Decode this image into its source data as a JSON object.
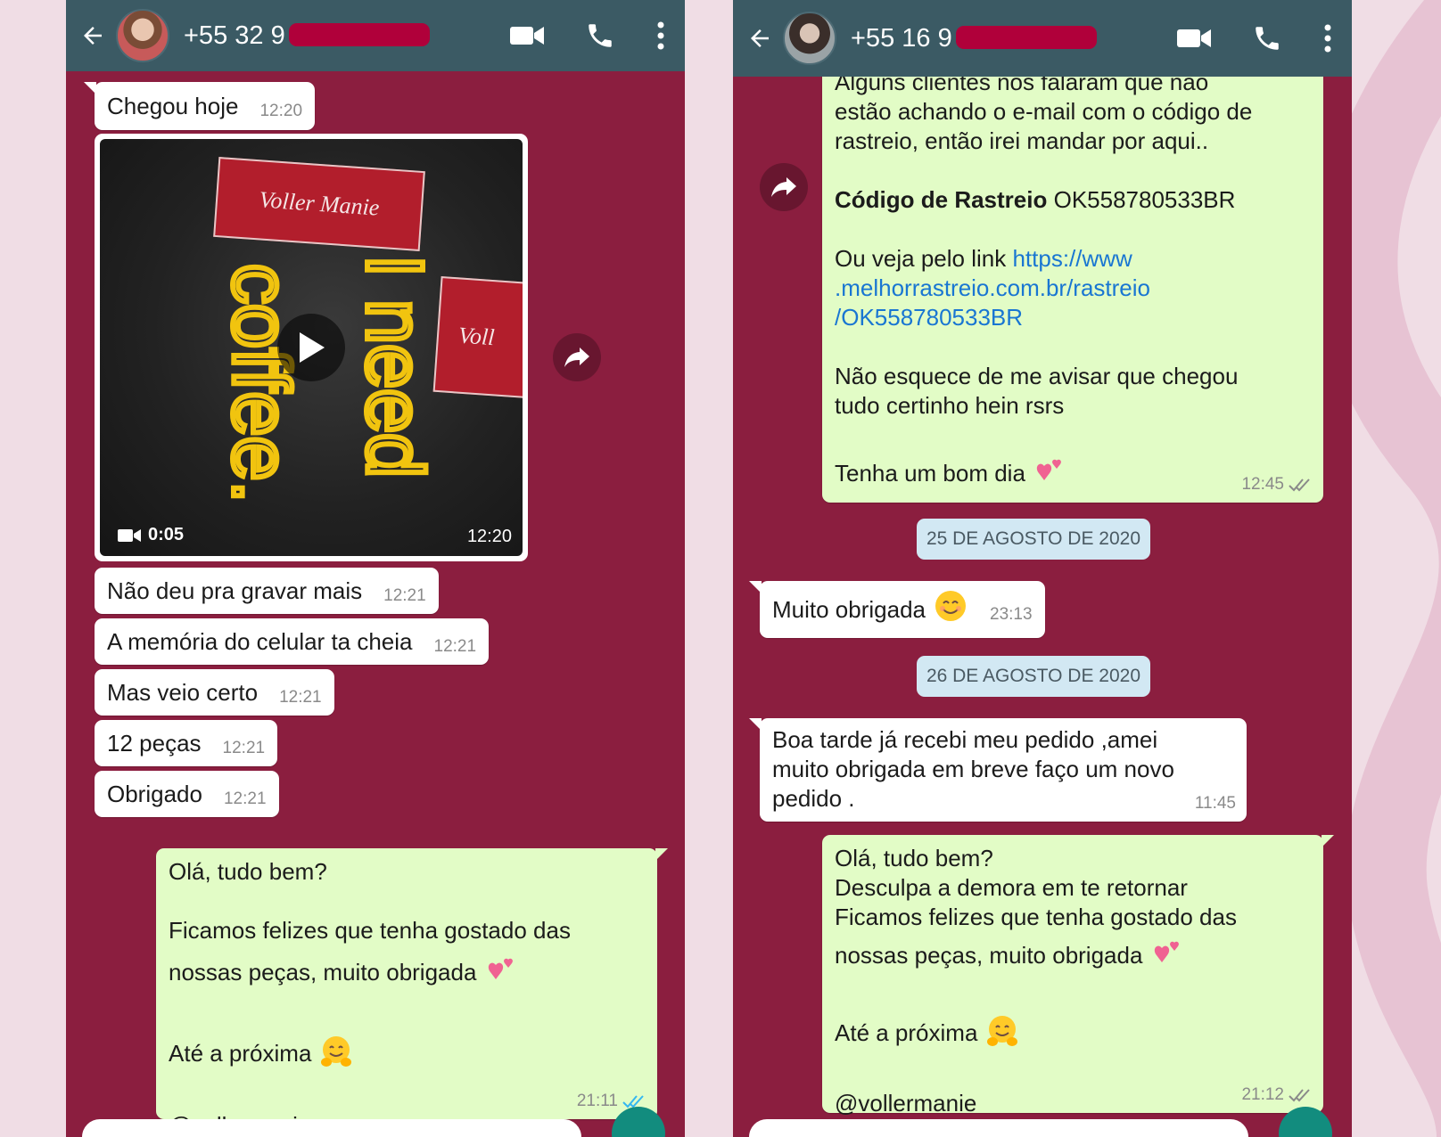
{
  "left": {
    "header": {
      "number": "+55 32 9"
    },
    "incoming": [
      {
        "text": "Chegou hoje",
        "time": "12:20"
      },
      {
        "text": "Não deu pra gravar mais",
        "time": "12:21"
      },
      {
        "text": "A memória do celular ta cheia",
        "time": "12:21"
      },
      {
        "text": "Mas veio certo",
        "time": "12:21"
      },
      {
        "text": "12 peças",
        "time": "12:21"
      },
      {
        "text": "Obrigado",
        "time": "12:21"
      }
    ],
    "video": {
      "duration": "0:05",
      "time": "12:20",
      "brand_tag": "Voller Manie",
      "brand_tag_partial": "Voll",
      "shirt_text_1": "coffee.",
      "shirt_text_2": "I need"
    },
    "outgoing": {
      "line1": "Olá, tudo bem?",
      "line2": "Ficamos felizes que tenha gostado das",
      "line3": "nossas peças, muito obrigada",
      "line4": "Até a próxima",
      "line5": "@vollermanie",
      "time": "21:11",
      "tick_color": "#34b7f1"
    }
  },
  "right": {
    "header": {
      "number": "+55 16 9"
    },
    "tracking_message": {
      "line1": "Alguns clientes nos falaram que não",
      "line2": "estão achando o e-mail com o código de",
      "line3": "rastreio, então irei mandar por aqui..",
      "code_label": "Código de Rastreio",
      "code_value": "OK558780533BR",
      "link_intro": "Ou veja pelo link",
      "link1": "https://www",
      "link2": ".melhorrastreio.com.br/rastreio",
      "link3": "/OK558780533BR",
      "line4": "Não esquece de me avisar que chegou",
      "line5": "tudo certinho hein rsrs",
      "line6": "Tenha um bom dia",
      "time": "12:45",
      "tick_color": "#8a8a8a"
    },
    "date1": "25 DE AGOSTO DE 2020",
    "thanks": {
      "text": "Muito obrigada",
      "time": "23:13"
    },
    "date2": "26 DE AGOSTO DE 2020",
    "received": {
      "line1": "Boa tarde já recebi meu pedido ,amei",
      "line2": "muito obrigada em breve faço um novo",
      "line3": "pedido .",
      "time": "11:45"
    },
    "reply": {
      "line1": "Olá, tudo bem?",
      "line2": "Desculpa a demora em te retornar",
      "line3": "Ficamos felizes que tenha gostado das",
      "line4": "nossas peças, muito obrigada",
      "line5": "Até a próxima",
      "line6": "@vollermanie",
      "time": "21:12",
      "tick_color": "#8a8a8a"
    }
  },
  "colors": {
    "chat_background": "#8b1e3f",
    "header": "#3b5a64",
    "incoming_bubble": "#ffffff",
    "outgoing_bubble": "#e2fcc6",
    "date_chip": "#d2e8f3",
    "link": "#1976d2",
    "redaction": "#b0003a"
  },
  "icons": [
    "back-arrow-icon",
    "video-call-icon",
    "phone-icon",
    "more-vert-icon",
    "forward-icon",
    "play-icon",
    "two-hearts-emoji",
    "smiling-face-emoji",
    "hugging-face-emoji",
    "double-check-icon"
  ]
}
